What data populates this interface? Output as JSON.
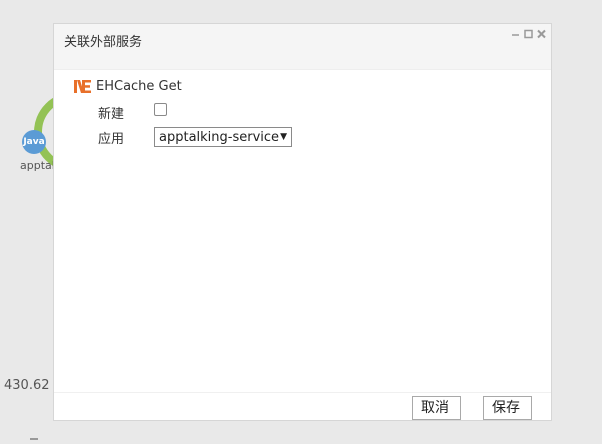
{
  "background": {
    "node_label": "apptall",
    "java_badge": "Java",
    "metric_value": "430.62",
    "ring_color": "#93c255"
  },
  "dialog": {
    "title": "关联外部服务",
    "controls": {
      "minimize_icon": "minimize-icon",
      "maximize_icon": "maximize-icon",
      "close_icon": "close-icon"
    },
    "service": {
      "icon": "ehcache-icon",
      "icon_color": "#e8702a",
      "name": "EHCache Get"
    },
    "form": {
      "new_label": "新建",
      "new_checked": false,
      "app_label": "应用",
      "app_selected": "apptalking-service"
    },
    "footer": {
      "cancel_label": "取消",
      "save_label": "保存"
    }
  }
}
